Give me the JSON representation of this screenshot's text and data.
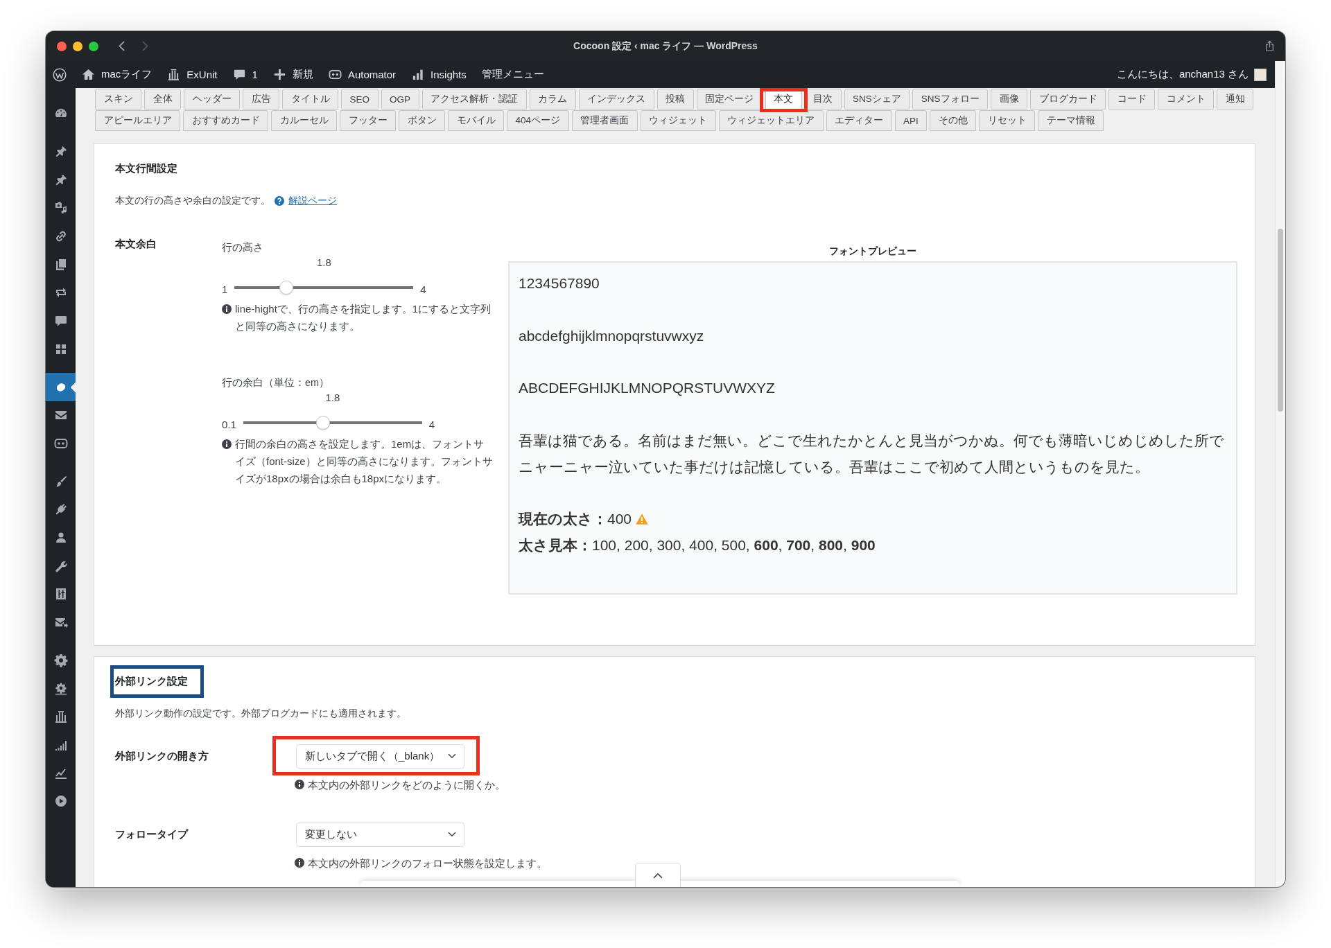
{
  "window": {
    "title": "Cocoon 設定 ‹ mac ライフ — WordPress",
    "back_disabled": false,
    "forward_disabled": true
  },
  "admin_bar": {
    "items": [
      {
        "label": "macライフ"
      },
      {
        "label": "ExUnit"
      },
      {
        "label": "1"
      },
      {
        "label": "新規"
      },
      {
        "label": "Automator"
      },
      {
        "label": "Insights"
      },
      {
        "label": "管理メニュー"
      }
    ],
    "greeting": "こんにちは、anchan13 さん"
  },
  "sidebar": {
    "groups": [
      {
        "items": [
          {
            "selected": false
          }
        ]
      },
      {
        "items": [
          {
            "selected": false
          },
          {
            "selected": false
          },
          {
            "selected": false
          },
          {
            "selected": false
          },
          {
            "selected": false
          },
          {
            "selected": false
          },
          {
            "selected": false
          },
          {
            "selected": false
          }
        ]
      },
      {
        "items": [
          {
            "selected": true
          },
          {
            "selected": false
          },
          {
            "selected": false
          }
        ]
      },
      {
        "items": [
          {
            "selected": false
          },
          {
            "selected": false
          },
          {
            "selected": false
          },
          {
            "selected": false
          },
          {
            "selected": false
          },
          {
            "selected": false
          }
        ]
      },
      {
        "items": [
          {
            "selected": false
          },
          {
            "selected": false
          },
          {
            "selected": false
          },
          {
            "selected": false
          },
          {
            "selected": false
          },
          {
            "selected": false
          }
        ]
      }
    ]
  },
  "tab_rows": [
    {
      "tabs": [
        {
          "label": "スキン",
          "selected": false
        },
        {
          "label": "全体",
          "selected": false
        },
        {
          "label": "ヘッダー",
          "selected": false
        },
        {
          "label": "広告",
          "selected": false
        },
        {
          "label": "タイトル",
          "selected": false
        },
        {
          "label": "SEO",
          "selected": false
        },
        {
          "label": "OGP",
          "selected": false
        },
        {
          "label": "アクセス解析・認証",
          "selected": false
        },
        {
          "label": "カラム",
          "selected": false
        },
        {
          "label": "インデックス",
          "selected": false
        },
        {
          "label": "投稿",
          "selected": false
        },
        {
          "label": "固定ページ",
          "selected": false
        },
        {
          "label": "本文",
          "selected": true,
          "annotation": {
            "color": "#e8301e"
          }
        },
        {
          "label": "目次",
          "selected": false
        },
        {
          "label": "SNSシェア",
          "selected": false
        },
        {
          "label": "SNSフォロー",
          "selected": false
        },
        {
          "label": "画像",
          "selected": false
        },
        {
          "label": "ブログカード",
          "selected": false
        },
        {
          "label": "コード",
          "selected": false
        },
        {
          "label": "コメント",
          "selected": false
        },
        {
          "label": "通知",
          "selected": false
        }
      ]
    },
    {
      "tabs": [
        {
          "label": "アピールエリア",
          "selected": false
        },
        {
          "label": "おすすめカード",
          "selected": false
        },
        {
          "label": "カルーセル",
          "selected": false
        },
        {
          "label": "フッター",
          "selected": false
        },
        {
          "label": "ボタン",
          "selected": false
        },
        {
          "label": "モバイル",
          "selected": false
        },
        {
          "label": "404ページ",
          "selected": false
        },
        {
          "label": "管理者画面",
          "selected": false
        },
        {
          "label": "ウィジェット",
          "selected": false
        },
        {
          "label": "ウィジェットエリア",
          "selected": false
        },
        {
          "label": "エディター",
          "selected": false
        },
        {
          "label": "API",
          "selected": false
        },
        {
          "label": "その他",
          "selected": false
        },
        {
          "label": "リセット",
          "selected": false
        },
        {
          "label": "テーマ情報",
          "selected": false
        }
      ]
    }
  ],
  "line_spacing_panel": {
    "title": "本文行間設定",
    "description": "本文の行の高さや余白の設定です。",
    "help_link": "解説ページ",
    "label": "本文余白",
    "sliders": [
      {
        "label": "行の高さ",
        "value": "1.8",
        "min": "1",
        "max": "4",
        "level": 0.27,
        "help": "line-hightで、行の高さを指定します。1にすると文字列と同等の高さになります。"
      },
      {
        "label": "行の余白（単位：em）",
        "value": "1.8",
        "min": "0.1",
        "max": "4",
        "level": 0.44,
        "help": "行間の余白の高さを設定します。1emは、フォントサイズ（font-size）と同等の高さになります。フォントサイズが18pxの場合は余白も18pxになります。"
      }
    ],
    "preview": {
      "title": "フォントプレビュー",
      "lines": [
        "1234567890",
        "abcdefghijklmnopqrstuvwxyz",
        "ABCDEFGHIJKLMNOPQRSTUVWXYZ",
        "吾輩は猫である。名前はまだ無い。どこで生れたかとんと見当がつかぬ。何でも薄暗いじめじめした所でニャーニャー泣いていた事だけは記憶している。吾輩はここで初めて人間というものを見た。"
      ],
      "current_weight": "**現在の太さ：**400",
      "weight_warning": true,
      "weight_samples": "**太さ見本：**100, 200, 300, 400, 500, **600**, **700**, **800**, **900**"
    }
  },
  "external_link_panel": {
    "title": "外部リンク設定",
    "title_annotation": {
      "color": "#1b4c82"
    },
    "description": "外部リンク動作の設定です。外部ブログカードにも適用されます。",
    "fields": [
      {
        "label": "外部リンクの開き方",
        "value": "新しいタブで開く（_blank）",
        "help": "本文内の外部リンクをどのように開くか。",
        "annotation": {
          "color": "#e8301e"
        }
      },
      {
        "label": "フォロータイプ",
        "value": "変更しない",
        "help": "本文内の外部リンクのフォロー状態を設定します。"
      }
    ]
  }
}
